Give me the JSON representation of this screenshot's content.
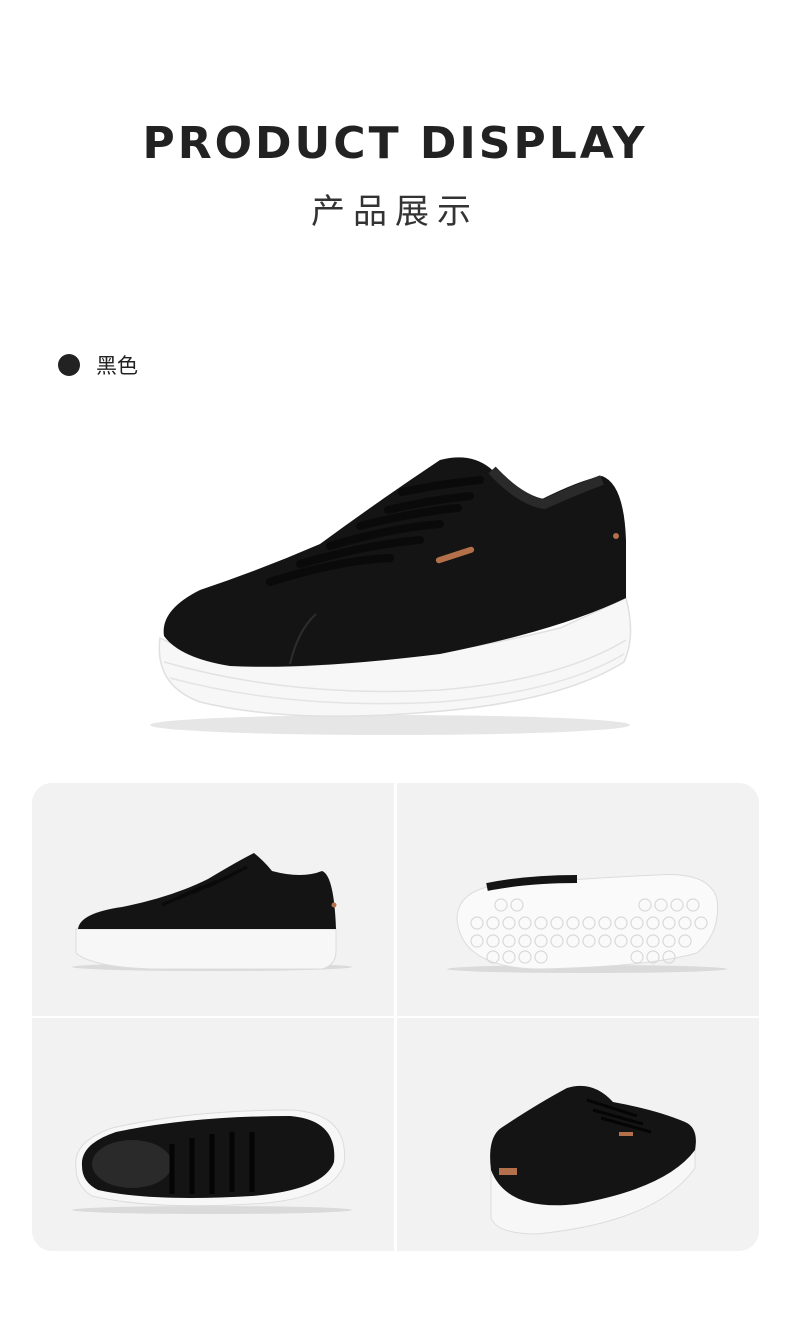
{
  "header": {
    "title": "PRODUCT DISPLAY",
    "subtitle": "产品展示"
  },
  "color_option": {
    "label": "黑色",
    "swatch_color": "#222222"
  },
  "views": [
    {
      "icon": "shoe-side-view"
    },
    {
      "icon": "shoe-sole-view"
    },
    {
      "icon": "shoe-top-view"
    },
    {
      "icon": "shoe-back-view"
    }
  ],
  "colors": {
    "upper": "#141414",
    "sole": "#f7f7f7",
    "panel_bg": "#f2f2f2",
    "accent": "#b4704a"
  }
}
